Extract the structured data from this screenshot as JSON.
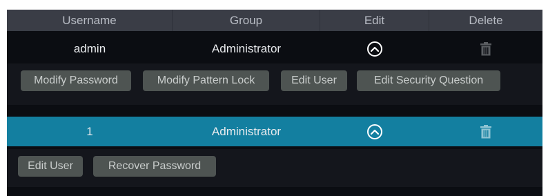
{
  "table": {
    "columns": [
      "Username",
      "Group",
      "Edit",
      "Delete"
    ],
    "rows": [
      {
        "username": "admin",
        "group": "Administrator",
        "edit_icon": "chevron-up-circle-icon",
        "delete_icon": "trash-icon",
        "selected": false,
        "actions": [
          "Modify Password",
          "Modify Pattern Lock",
          "Edit User",
          "Edit Security Question"
        ]
      },
      {
        "username": "1",
        "group": "Administrator",
        "edit_icon": "chevron-up-circle-icon",
        "delete_icon": "trash-icon",
        "selected": true,
        "actions": [
          "Edit User",
          "Recover Password"
        ]
      }
    ]
  },
  "colors": {
    "header_bg": "#3a3d46",
    "selected_row": "#137fa0",
    "button_bg": "#4e5452",
    "background": "#0b0d12"
  }
}
